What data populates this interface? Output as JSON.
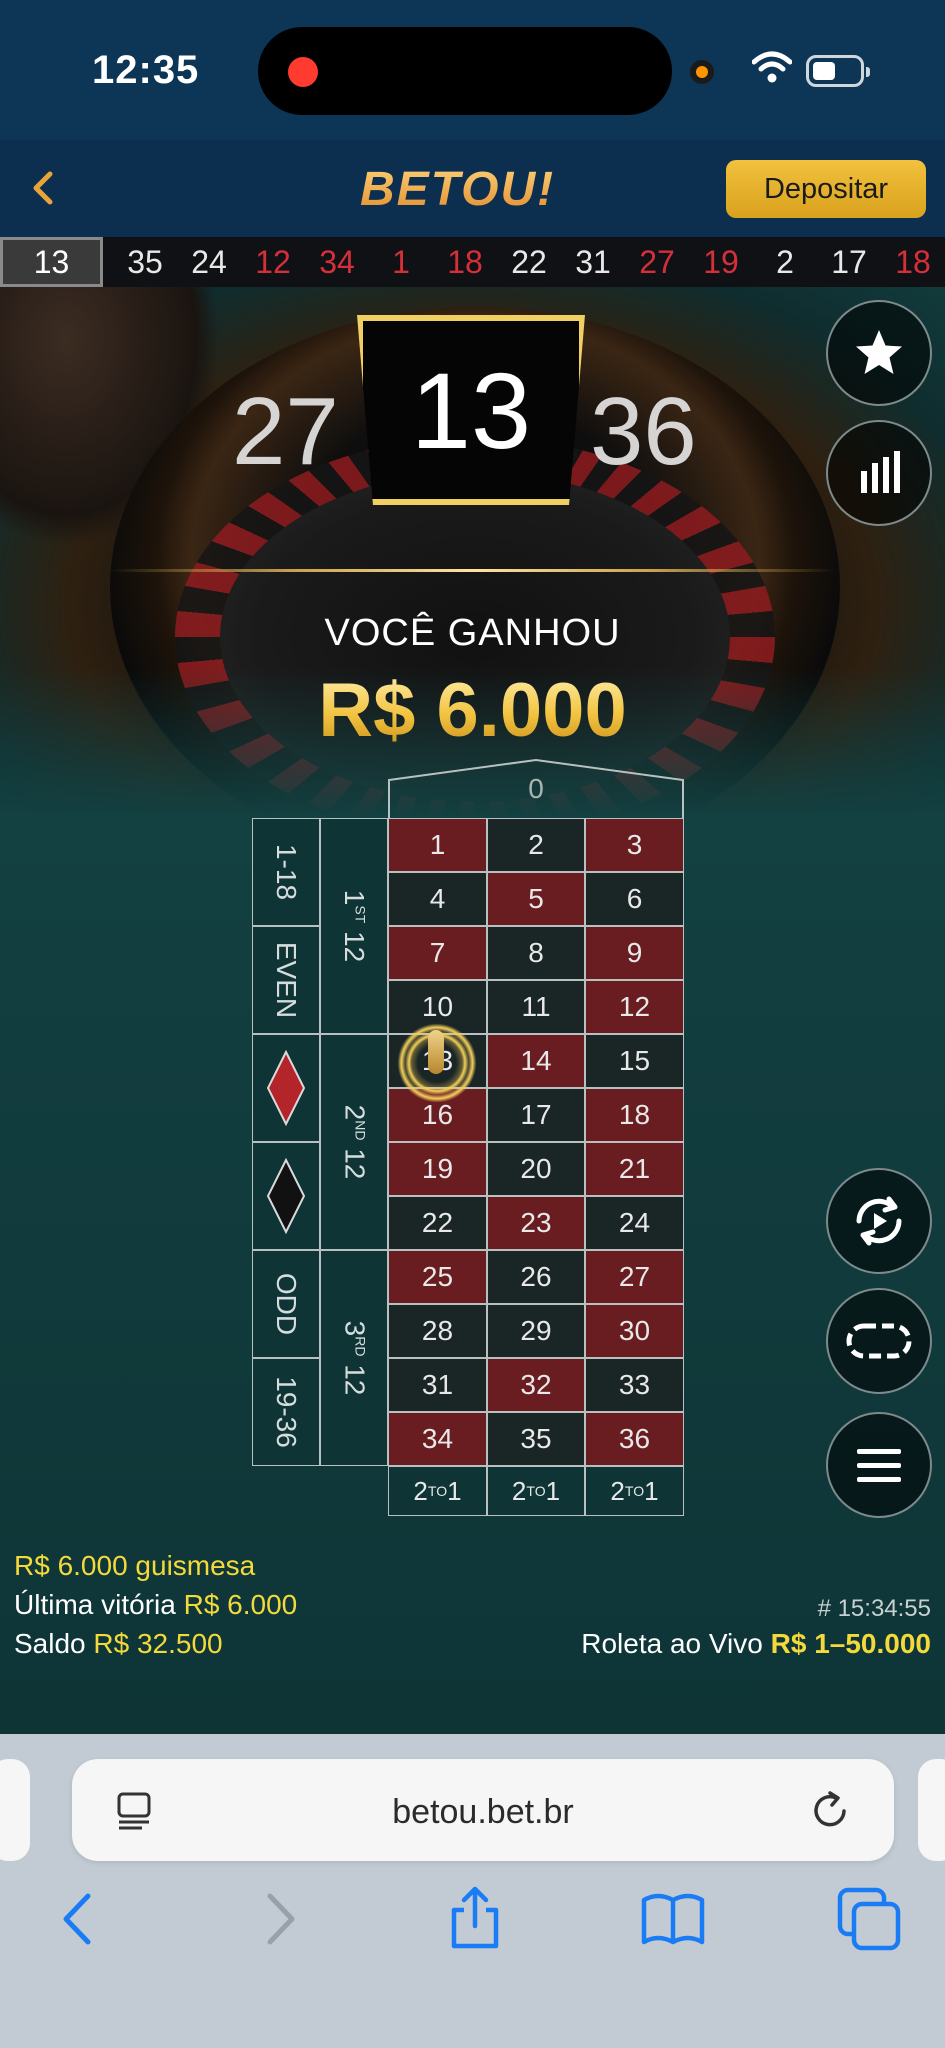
{
  "status_bar": {
    "time": "12:35"
  },
  "header": {
    "logo": "BETOU!",
    "deposit_label": "Depositar"
  },
  "history": [
    {
      "n": "13",
      "c": "w",
      "current": true
    },
    {
      "n": "35",
      "c": "w"
    },
    {
      "n": "24",
      "c": "w"
    },
    {
      "n": "12",
      "c": "r"
    },
    {
      "n": "34",
      "c": "r"
    },
    {
      "n": "1",
      "c": "r"
    },
    {
      "n": "18",
      "c": "r"
    },
    {
      "n": "22",
      "c": "w"
    },
    {
      "n": "31",
      "c": "w"
    },
    {
      "n": "27",
      "c": "r"
    },
    {
      "n": "19",
      "c": "r"
    },
    {
      "n": "2",
      "c": "w"
    },
    {
      "n": "17",
      "c": "w"
    },
    {
      "n": "18",
      "c": "r"
    }
  ],
  "result": {
    "left": "27",
    "current": "13",
    "right": "36",
    "win_label": "VOCÊ GANHOU",
    "win_amount": "R$ 6.000"
  },
  "table": {
    "zero": "0",
    "rows": [
      [
        {
          "n": "1",
          "c": "red"
        },
        {
          "n": "2",
          "c": "black"
        },
        {
          "n": "3",
          "c": "red"
        }
      ],
      [
        {
          "n": "4",
          "c": "black"
        },
        {
          "n": "5",
          "c": "red"
        },
        {
          "n": "6",
          "c": "black"
        }
      ],
      [
        {
          "n": "7",
          "c": "red"
        },
        {
          "n": "8",
          "c": "black"
        },
        {
          "n": "9",
          "c": "red"
        }
      ],
      [
        {
          "n": "10",
          "c": "black"
        },
        {
          "n": "11",
          "c": "black"
        },
        {
          "n": "12",
          "c": "red"
        }
      ],
      [
        {
          "n": "13",
          "c": "black"
        },
        {
          "n": "14",
          "c": "red"
        },
        {
          "n": "15",
          "c": "black"
        }
      ],
      [
        {
          "n": "16",
          "c": "red"
        },
        {
          "n": "17",
          "c": "black"
        },
        {
          "n": "18",
          "c": "red"
        }
      ],
      [
        {
          "n": "19",
          "c": "red"
        },
        {
          "n": "20",
          "c": "black"
        },
        {
          "n": "21",
          "c": "red"
        }
      ],
      [
        {
          "n": "22",
          "c": "black"
        },
        {
          "n": "23",
          "c": "red"
        },
        {
          "n": "24",
          "c": "black"
        }
      ],
      [
        {
          "n": "25",
          "c": "red"
        },
        {
          "n": "26",
          "c": "black"
        },
        {
          "n": "27",
          "c": "red"
        }
      ],
      [
        {
          "n": "28",
          "c": "black"
        },
        {
          "n": "29",
          "c": "black"
        },
        {
          "n": "30",
          "c": "red"
        }
      ],
      [
        {
          "n": "31",
          "c": "black"
        },
        {
          "n": "32",
          "c": "red"
        },
        {
          "n": "33",
          "c": "black"
        }
      ],
      [
        {
          "n": "34",
          "c": "red"
        },
        {
          "n": "35",
          "c": "black"
        },
        {
          "n": "36",
          "c": "red"
        }
      ]
    ],
    "outside": {
      "low": "1-18",
      "even": "EVEN",
      "odd": "ODD",
      "high": "19-36"
    },
    "dozens": {
      "first": "1",
      "second": "2",
      "third": "3",
      "first_sup": "ST",
      "second_sup": "ND",
      "third_sup": "RD",
      "suffix": " 12"
    },
    "column_bet": {
      "a": "2",
      "sup": "TO",
      "b": "1"
    }
  },
  "info": {
    "line1_amount": "R$ 6.000",
    "line1_user": "guismesa",
    "last_win_label": "Última vitória",
    "last_win_amount": "R$ 6.000",
    "balance_label": "Saldo",
    "balance_amount": "R$ 32.500",
    "round_id": "# 15:34:55",
    "game_label": "Roleta ao Vivo",
    "limits": "R$ 1–50.000"
  },
  "browser": {
    "url": "betou.bet.br"
  },
  "colors": {
    "accent_gold": "#f2c13d",
    "red_cell": "#6a1d21",
    "black_cell": "#1a2526",
    "felt": "#134041"
  }
}
